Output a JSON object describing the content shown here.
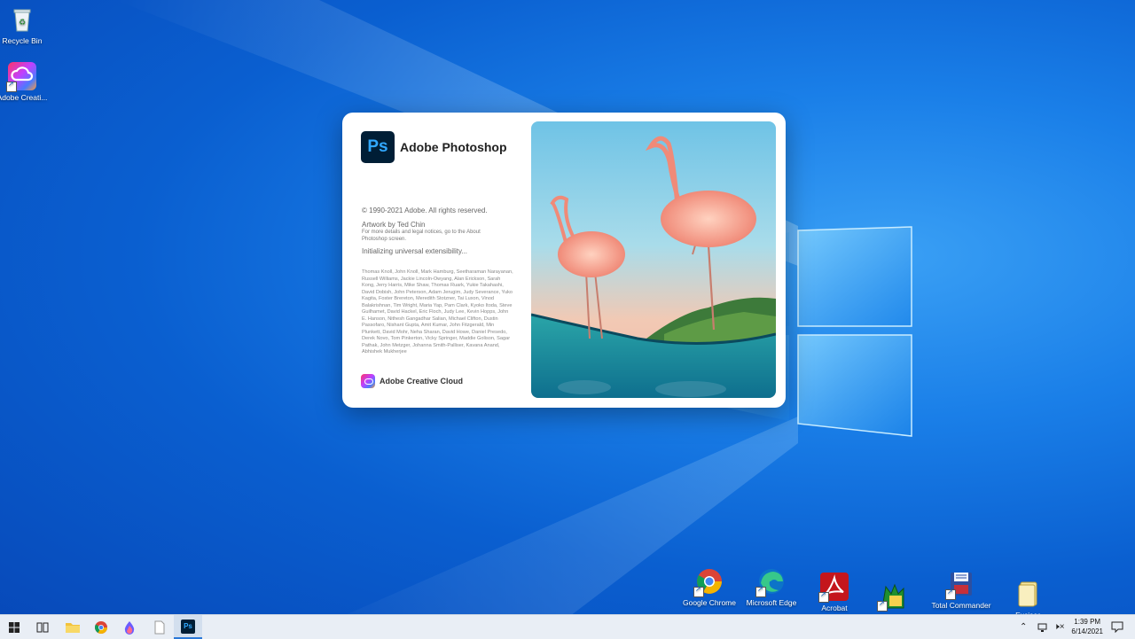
{
  "desktop": {
    "icons_left": [
      {
        "label": "Recycle Bin",
        "icon": "recycle-bin-icon"
      },
      {
        "label": "Adobe Creati...",
        "icon": "creative-cloud-icon"
      }
    ],
    "icons_bottom": [
      {
        "label": "Google Chrome",
        "icon": "chrome-icon"
      },
      {
        "label": "Microsoft Edge",
        "icon": "edge-icon"
      },
      {
        "label": "Acrobat",
        "icon": "acrobat-icon"
      },
      {
        "label": "",
        "icon": "app-icon"
      },
      {
        "label": "Total Commander",
        "icon": "total-commander-icon"
      },
      {
        "label": "Exciser",
        "icon": "folder-icon"
      }
    ]
  },
  "splash": {
    "logo_text": "Ps",
    "app_name": "Adobe Photoshop",
    "copyright": "© 1990-2021 Adobe. All rights reserved.",
    "artwork": "Artwork by Ted Chin",
    "notice": "For more details and legal notices, go to the About Photoshop screen.",
    "status": "Initializing universal extensibility...",
    "credits": "Thomas Knoll, John Knoll, Mark Hamburg, Seetharaman Narayanan, Russell Williams, Jackie Lincoln-Owyang, Alan Erickson, Sarah Kong, Jerry Harris, Mike Shaw, Thomas Ruark, Yukie Takahashi, David Dobish, John Peterson, Adam Jerugim, Judy Severance, Yuko Kagita, Foster Brereton, Meredith Stotzner, Tai Luxon, Vinod Balakrishnan, Tim Wright, Maria Yap, Pam Clark, Kyoko Itoda, Steve Guilhamet, David Hackel, Eric Floch, Judy Lee, Kevin Hopps, John E. Hanson, Nithesh Gangadhar Salian, Michael Clifton, Dustin Passofaro, Nishant Gupta, Amit Kumar, John Fitzgerald, Min Plunkett, David Mohr, Neha Sharan, David Howe, Daniel Presedo, Derek Novo, Tom Pinkerton, Vicky Springer, Maddie Golison, Sagar Pathak, John Metzger, Johanna Smith-Palliser, Kavana Anand, Abhishek Mukherjee",
    "cc_label": "Adobe Creative Cloud"
  },
  "taskbar": {
    "items": [
      "start-icon",
      "task-view-icon",
      "file-explorer-icon",
      "chrome-icon",
      "app-icon",
      "file-icon",
      "photoshop-icon"
    ],
    "active_item": "photoshop-icon",
    "photoshop_label": "Ps",
    "time": "1:39 PM",
    "date": "6/14/2021"
  },
  "colors": {
    "accent": "#2a78d8",
    "ps_bg": "#001e36",
    "ps_fg": "#31a8ff"
  }
}
